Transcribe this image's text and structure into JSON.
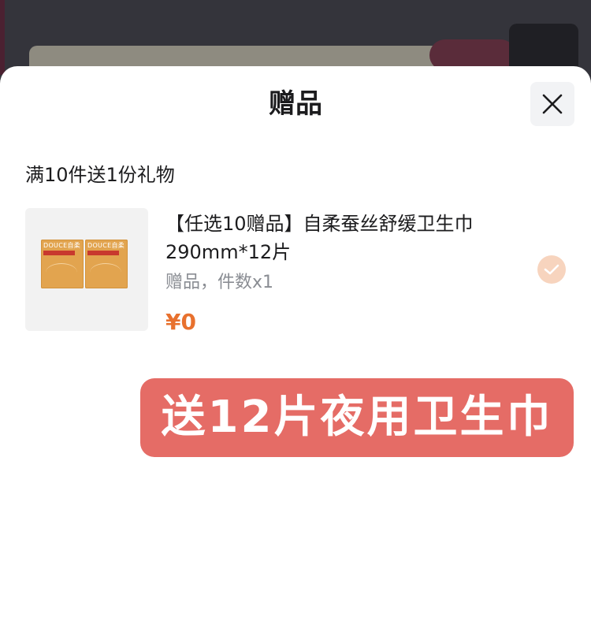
{
  "sheet": {
    "title": "赠品",
    "close_icon": "close-icon"
  },
  "gift_section": {
    "label": "满10件送1份礼物"
  },
  "gift_item": {
    "name": "【任选10赠品】自柔蚕丝舒缓卫生巾290mm*12片",
    "meta": "赠品，件数x1",
    "price": "¥0",
    "thumbnail_brand": "DOUCE自柔",
    "selected": true,
    "check_icon": "check-circle-icon"
  },
  "promo_banner": {
    "text": "送12片夜用卫生巾"
  },
  "colors": {
    "price": "#e8712e",
    "banner": "#e56c66",
    "check_bg": "#f7d4be",
    "title": "#1c1c1e",
    "meta": "#8a8d93"
  }
}
